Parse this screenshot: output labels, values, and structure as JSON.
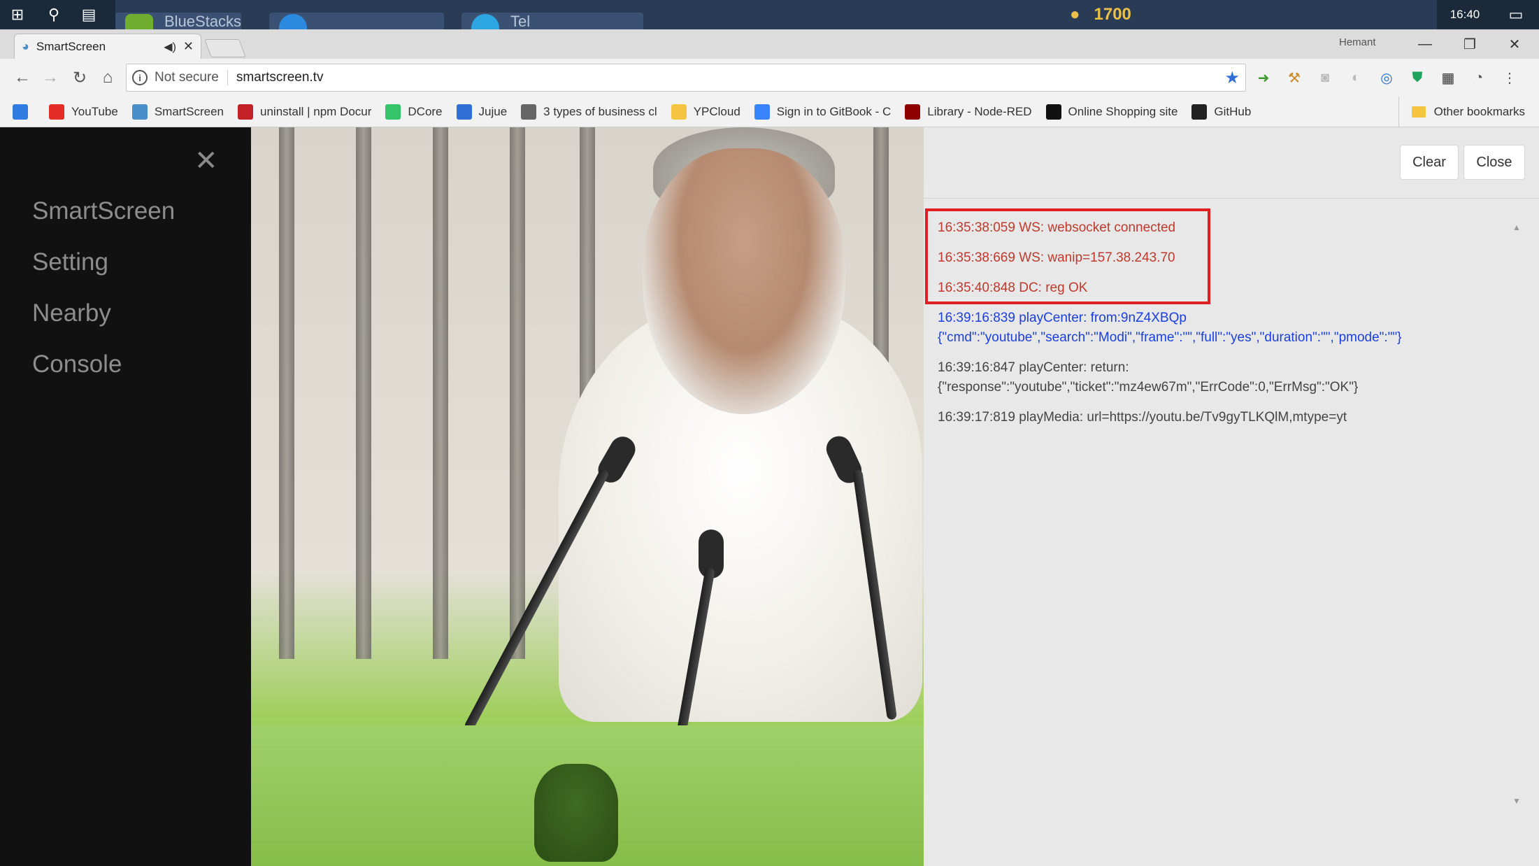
{
  "taskbar": {
    "clock": "16:40",
    "apps": [
      "BlueStacks",
      "",
      "Tel"
    ],
    "tray_badge": "1700"
  },
  "browser": {
    "tab_title": "SmartScreen",
    "profile": "Hemant",
    "address": {
      "security_label": "Not secure",
      "url": "smartscreen.tv"
    },
    "bookmarks": [
      {
        "label": "",
        "icon": "cursor-icon",
        "color": "#2f7de1"
      },
      {
        "label": "YouTube",
        "icon": "youtube-icon",
        "color": "#e52d27"
      },
      {
        "label": "SmartScreen",
        "icon": "smartscreen-icon",
        "color": "#4a8ec9"
      },
      {
        "label": "uninstall | npm Docur",
        "icon": "npm-icon",
        "color": "#c12127"
      },
      {
        "label": "DCore",
        "icon": "dcore-icon",
        "color": "#36c46a"
      },
      {
        "label": "Jujue",
        "icon": "bird-icon",
        "color": "#2f6fd6"
      },
      {
        "label": "3 types of business cl",
        "icon": "bike-icon",
        "color": "#666666"
      },
      {
        "label": "YPCloud",
        "icon": "folder-icon",
        "color": "#f5c542"
      },
      {
        "label": "Sign in to GitBook - C",
        "icon": "gitbook-icon",
        "color": "#3884ff"
      },
      {
        "label": "Library - Node-RED",
        "icon": "nodered-icon",
        "color": "#8f0000"
      },
      {
        "label": "Online Shopping site",
        "icon": "amazon-icon",
        "color": "#111111"
      },
      {
        "label": "GitHub",
        "icon": "github-icon",
        "color": "#222222"
      }
    ],
    "other_bookmarks": "Other bookmarks"
  },
  "sidenav": {
    "items": [
      "SmartScreen",
      "Setting",
      "Nearby",
      "Console"
    ]
  },
  "console": {
    "clear_label": "Clear",
    "close_label": "Close",
    "logs": [
      {
        "text": "16:35:38:059 WS: websocket connected",
        "color": "#c0392b"
      },
      {
        "text": "16:35:38:669 WS: wanip=157.38.243.70",
        "color": "#c0392b"
      },
      {
        "text": "16:35:40:848 DC: reg OK",
        "color": "#c0392b"
      },
      {
        "text": "16:39:16:839 playCenter: from:9nZ4XBQp\n{\"cmd\":\"youtube\",\"search\":\"Modi\",\"frame\":\"\",\"full\":\"yes\",\"duration\":\"\",\"pmode\":\"\"}",
        "color": "#1a3fe0"
      },
      {
        "text": "16:39:16:847 playCenter: return:\n{\"response\":\"youtube\",\"ticket\":\"mz4ew67m\",\"ErrCode\":0,\"ErrMsg\":\"OK\"}",
        "color": "#444444"
      },
      {
        "text": "16:39:17:819 playMedia: url=https://youtu.be/Tv9gyTLKQlM,mtype=yt",
        "color": "#444444"
      }
    ]
  }
}
